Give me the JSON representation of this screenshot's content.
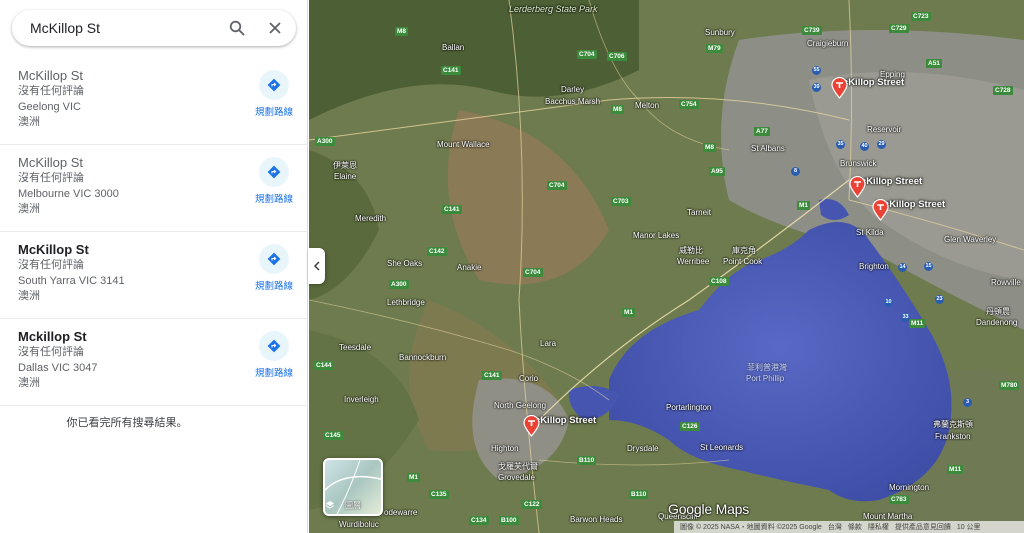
{
  "search": {
    "value": "McKillop St"
  },
  "results": [
    {
      "title": "McKillop St",
      "reviews": "沒有任何評論",
      "locality": "Geelong VIC",
      "country": "澳洲",
      "directions": "規劃路線",
      "bold": false
    },
    {
      "title": "McKillop St",
      "reviews": "沒有任何評論",
      "locality": "Melbourne VIC 3000",
      "country": "澳洲",
      "directions": "規劃路線",
      "bold": false
    },
    {
      "title": "McKillop St",
      "reviews": "沒有任何評論",
      "locality": "South Yarra VIC 3141",
      "country": "澳洲",
      "directions": "規劃路線",
      "bold": true
    },
    {
      "title": "Mckillop St",
      "reviews": "沒有任何評論",
      "locality": "Dallas VIC 3047",
      "country": "澳洲",
      "directions": "規劃路線",
      "bold": true
    }
  ],
  "end_message": "你已看完所有搜尋結果。",
  "map": {
    "places": [
      "Lerderberg State Park",
      "Ballan",
      "Sunbury",
      "Craigieburn",
      "Epping",
      "Darley",
      "Bacchus Marsh",
      "Melton",
      "Mount Wallace",
      "Reservoir",
      "St Albans",
      "伊萊恩",
      "Elaine",
      "Brunswick",
      "Meredith",
      "Tarneit",
      "Manor Lakes",
      "St Kilda",
      "Glen Waverley",
      "She Oaks",
      "Anakie",
      "威勒比",
      "Werribee",
      "庫克角",
      "Point Cook",
      "Brighton",
      "Lethbridge",
      "Rowville",
      "丹頓農",
      "Dandenong",
      "Teesdale",
      "Bannockburn",
      "Lara",
      "菲利普港灣",
      "Port Phillip",
      "Inverleigh",
      "Corio",
      "North Geelong",
      "Portarlington",
      "Frankston",
      "弗蘭克斯頓",
      "Drysdale",
      "St Leonards",
      "Highton",
      "戈羅芙代爾",
      "Grovedale",
      "Mornington",
      "Mount Martha",
      "Wurdiboluc",
      "odewarre",
      "Barwon Heads",
      "Queenscliff"
    ],
    "pins": [
      {
        "label": "McKillop Street"
      },
      {
        "label": "McKillop Street"
      },
      {
        "label": "McKillop Street"
      },
      {
        "label": "McKillop Street"
      }
    ],
    "layers_label": "圖層",
    "logo": "Google Maps",
    "attribution": "圖像 © 2025 NASA・地圖資料 ©2025 Google",
    "footer_links": [
      "台灣",
      "條款",
      "隱私權",
      "提供產品意見回饋",
      "10 公里"
    ],
    "colors": {
      "pin": "#ea4335",
      "water": "#4a5bb8",
      "land": "#6b7b4a"
    }
  }
}
